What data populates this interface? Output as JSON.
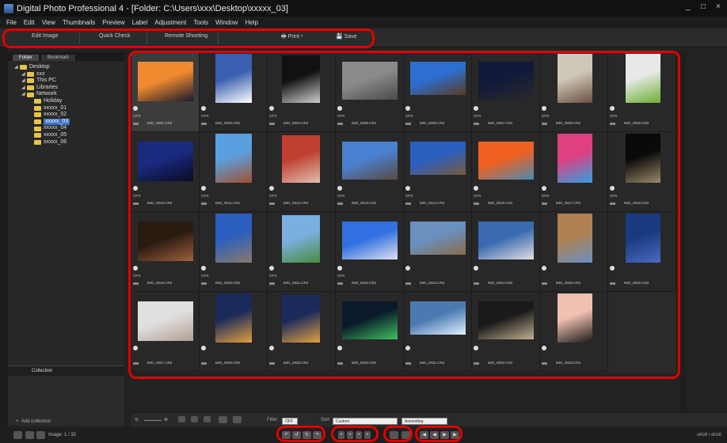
{
  "window": {
    "title": "Digital Photo Professional 4 - [Folder: C:\\Users\\xxx\\Desktop\\xxxxx_03]",
    "minimize": "_",
    "restore": "□",
    "close": "×"
  },
  "menu": [
    "File",
    "Edit",
    "View",
    "Thumbnails",
    "Preview",
    "Label",
    "Adjustment",
    "Tools",
    "Window",
    "Help"
  ],
  "toolbar": {
    "edit_image": "Edit Image",
    "quick_check": "Quick Check",
    "remote_shooting": "Remote Shooting",
    "print": "Print",
    "save": "Save"
  },
  "sidebar": {
    "tabs": [
      "Folder",
      "Bookmark"
    ],
    "tree": [
      {
        "label": "Desktop",
        "depth": 0,
        "expanded": true
      },
      {
        "label": "xxx",
        "depth": 1
      },
      {
        "label": "This PC",
        "depth": 1
      },
      {
        "label": "Libraries",
        "depth": 1
      },
      {
        "label": "Network",
        "depth": 1
      },
      {
        "label": "Holiday",
        "depth": 2
      },
      {
        "label": "xxxxx_01",
        "depth": 2
      },
      {
        "label": "xxxxx_02",
        "depth": 2
      },
      {
        "label": "xxxxx_03",
        "depth": 2,
        "selected": true
      },
      {
        "label": "xxxxx_04",
        "depth": 2
      },
      {
        "label": "xxxxx_05",
        "depth": 2
      },
      {
        "label": "xxxxx_06",
        "depth": 2
      }
    ],
    "collection_title": "Collection",
    "add_collection": "Add collection"
  },
  "thumbnails": [
    {
      "name": "IMG_0001.CR2",
      "gps": "GPS",
      "colors": [
        "#f08a30",
        "#1a1a2a"
      ]
    },
    {
      "name": "IMG_0003.CR2",
      "gps": "GPS",
      "colors": [
        "#3a5fb0",
        "#ffffff"
      ]
    },
    {
      "name": "IMG_0004.CR2",
      "gps": "GPS",
      "colors": [
        "#111111",
        "#cfcfcf"
      ]
    },
    {
      "name": "IMG_0005.CR2",
      "gps": "GPS",
      "colors": [
        "#8a8a8a",
        "#4a4a4a"
      ]
    },
    {
      "name": "IMG_0006.CR2",
      "gps": "GPS",
      "colors": [
        "#2c6fd0",
        "#5a3a20"
      ]
    },
    {
      "name": "IMG_0007.CR2",
      "gps": "GPS",
      "colors": [
        "#111a3a",
        "#2a2a2a"
      ]
    },
    {
      "name": "IMG_0008.CR2",
      "gps": "GPS",
      "colors": [
        "#cfc7b8",
        "#6a5040"
      ]
    },
    {
      "name": "IMG_0009.CR2",
      "gps": "GPS",
      "colors": [
        "#e8e8e8",
        "#6ab030"
      ]
    },
    {
      "name": "IMG_0010.CR2",
      "gps": "GPS",
      "colors": [
        "#1a2a80",
        "#0a0a20"
      ]
    },
    {
      "name": "IMG_0011.CR2",
      "gps": "GPS",
      "colors": [
        "#5aa0e0",
        "#a05030"
      ]
    },
    {
      "name": "IMG_0012.CR2",
      "gps": "GPS",
      "colors": [
        "#c04030",
        "#e0c0b0"
      ]
    },
    {
      "name": "IMG_0013.CR2",
      "gps": "GPS",
      "colors": [
        "#4a80d0",
        "#5a4a40"
      ]
    },
    {
      "name": "IMG_0014.CR2",
      "gps": "GPS",
      "colors": [
        "#2a5fc0",
        "#7a5a3a"
      ]
    },
    {
      "name": "IMG_0015.CR2",
      "gps": "GPS",
      "colors": [
        "#f06020",
        "#4a8ab0"
      ]
    },
    {
      "name": "IMG_0017.CR2",
      "gps": "GPS",
      "colors": [
        "#e04080",
        "#30a0e0"
      ]
    },
    {
      "name": "IMG_0018.CR2",
      "gps": "GPS",
      "colors": [
        "#0a0a0a",
        "#9a8a6a"
      ]
    },
    {
      "name": "IMG_0019.CR2",
      "gps": "GPS",
      "colors": [
        "#2a1a10",
        "#a06040"
      ]
    },
    {
      "name": "IMG_0020.CR2",
      "gps": "GPS",
      "colors": [
        "#2a5fc0",
        "#8a7a6a"
      ]
    },
    {
      "name": "IMG_0021.CR2",
      "gps": "GPS",
      "colors": [
        "#7ab0e0",
        "#4a8a40"
      ]
    },
    {
      "name": "IMG_0022.CR2",
      "gps": "GPS",
      "colors": [
        "#3070e0",
        "#e0e0f0"
      ]
    },
    {
      "name": "IMG_0023.CR2",
      "gps": "",
      "colors": [
        "#6a90c0",
        "#8a6a4a"
      ]
    },
    {
      "name": "IMG_0024.CR2",
      "gps": "",
      "colors": [
        "#3a6ab0",
        "#e0e0e0"
      ]
    },
    {
      "name": "IMG_0025.CR2",
      "gps": "",
      "colors": [
        "#b08050",
        "#6a90c0"
      ]
    },
    {
      "name": "IMG_0026.CR2",
      "gps": "",
      "colors": [
        "#1a3a80",
        "#4a6ac0"
      ]
    },
    {
      "name": "IMG_0027.CR2",
      "gps": "",
      "colors": [
        "#e0e0e0",
        "#b0a090"
      ]
    },
    {
      "name": "IMG_0028.CR2",
      "gps": "",
      "colors": [
        "#1a2a5a",
        "#e0a040"
      ]
    },
    {
      "name": "IMG_0029.CR2",
      "gps": "",
      "colors": [
        "#1a2a5a",
        "#e0a040"
      ]
    },
    {
      "name": "IMG_0030.CR2",
      "gps": "",
      "colors": [
        "#0a1a2a",
        "#40c060"
      ]
    },
    {
      "name": "IMG_0031.CR2",
      "gps": "",
      "colors": [
        "#4a7ab0",
        "#e0f0ff"
      ]
    },
    {
      "name": "IMG_0032.CR2",
      "gps": "",
      "colors": [
        "#1a1a1a",
        "#c0b090"
      ]
    },
    {
      "name": "IMG_0033.CR2",
      "gps": "",
      "colors": [
        "#f0c0b0",
        "#1a1a1a"
      ]
    }
  ],
  "bottombar": {
    "filter_label": "Filter",
    "filter_value": "OFF",
    "sort_label": "Sort",
    "sort_value": "Custom",
    "order_value": "Ascending"
  },
  "statusbar": {
    "image_count": "Image: 1 / 32",
    "colorspace": "sRGB / sRGB"
  }
}
